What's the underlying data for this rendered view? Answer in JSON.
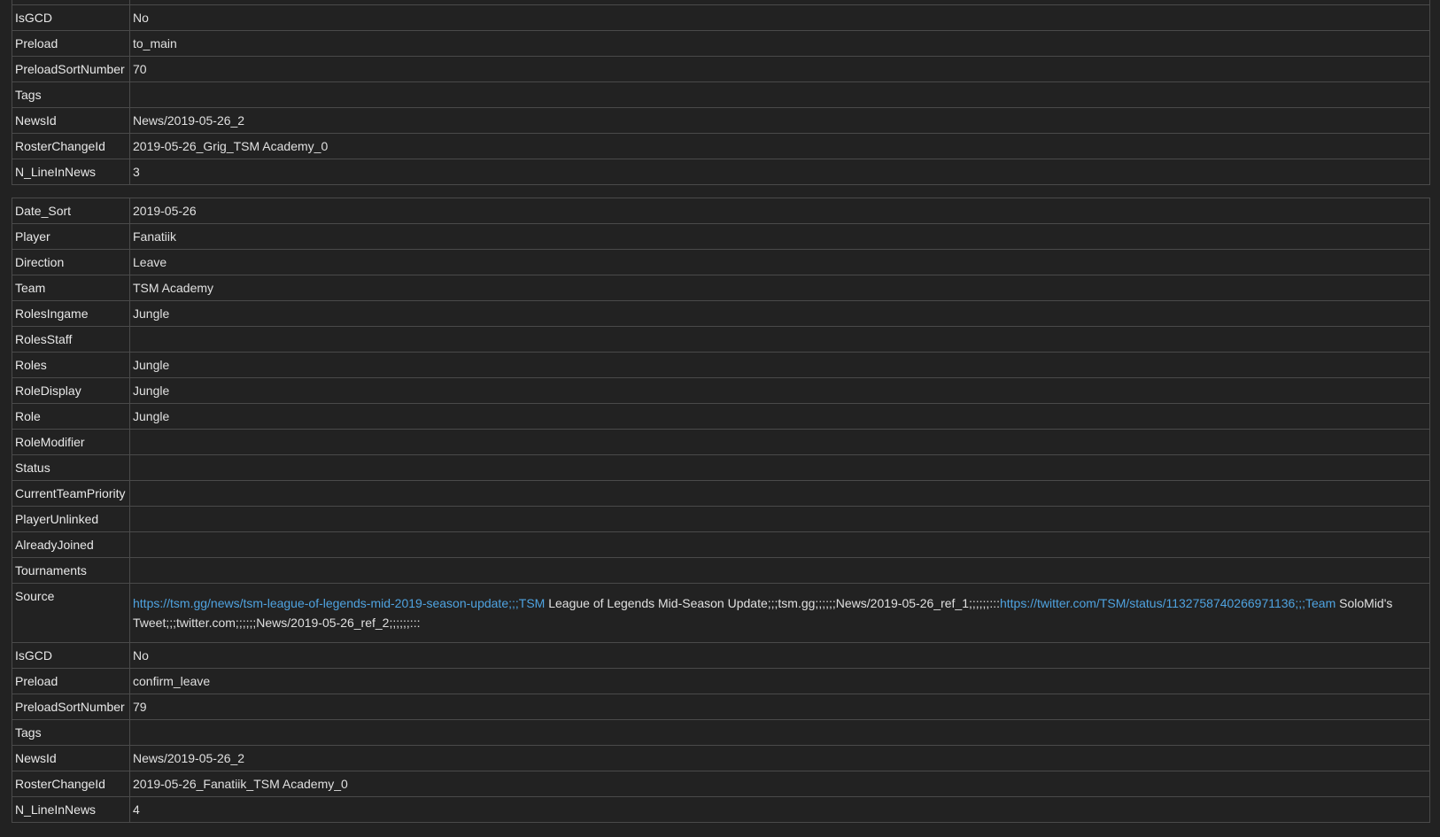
{
  "table1": {
    "rows": [
      {
        "key": "",
        "value": ""
      },
      {
        "key": "IsGCD",
        "value": "No"
      },
      {
        "key": "Preload",
        "value": "to_main"
      },
      {
        "key": "PreloadSortNumber",
        "value": "70"
      },
      {
        "key": "Tags",
        "value": ""
      },
      {
        "key": "NewsId",
        "value": "News/2019-05-26_2"
      },
      {
        "key": "RosterChangeId",
        "value": "2019-05-26_Grig_TSM Academy_0"
      },
      {
        "key": "N_LineInNews",
        "value": "3"
      }
    ]
  },
  "table2": {
    "rows_top": [
      {
        "key": "Date_Sort",
        "value": "2019-05-26"
      },
      {
        "key": "Player",
        "value": "Fanatiik"
      },
      {
        "key": "Direction",
        "value": "Leave"
      },
      {
        "key": "Team",
        "value": "TSM Academy"
      },
      {
        "key": "RolesIngame",
        "value": "Jungle"
      },
      {
        "key": "RolesStaff",
        "value": ""
      },
      {
        "key": "Roles",
        "value": "Jungle"
      },
      {
        "key": "RoleDisplay",
        "value": "Jungle"
      },
      {
        "key": "Role",
        "value": "Jungle"
      },
      {
        "key": "RoleModifier",
        "value": ""
      },
      {
        "key": "Status",
        "value": ""
      },
      {
        "key": "CurrentTeamPriority",
        "value": ""
      },
      {
        "key": "PlayerUnlinked",
        "value": ""
      },
      {
        "key": "AlreadyJoined",
        "value": ""
      },
      {
        "key": "Tournaments",
        "value": ""
      }
    ],
    "source": {
      "key": "Source",
      "link1": "https://tsm.gg/news/tsm-league-of-legends-mid-2019-season-update;;;TSM",
      "text1": " League of Legends Mid-Season Update;;;tsm.gg;;;;;;News/2019-05-26_ref_1;;;;;;:::",
      "link2": "https://twitter.com/TSM/status/1132758740266971136;;;Team",
      "text2": " SoloMid's Tweet;;;twitter.com;;;;;;News/2019-05-26_ref_2;;;;;;:::"
    },
    "rows_bottom": [
      {
        "key": "IsGCD",
        "value": "No"
      },
      {
        "key": "Preload",
        "value": "confirm_leave"
      },
      {
        "key": "PreloadSortNumber",
        "value": "79"
      },
      {
        "key": "Tags",
        "value": ""
      },
      {
        "key": "NewsId",
        "value": "News/2019-05-26_2"
      },
      {
        "key": "RosterChangeId",
        "value": "2019-05-26_Fanatiik_TSM Academy_0"
      },
      {
        "key": "N_LineInNews",
        "value": "4"
      }
    ]
  },
  "colors": {
    "background": "#222222",
    "border": "#4a4a4a",
    "link": "#4fa3e0",
    "text": "#e0e0e0"
  }
}
